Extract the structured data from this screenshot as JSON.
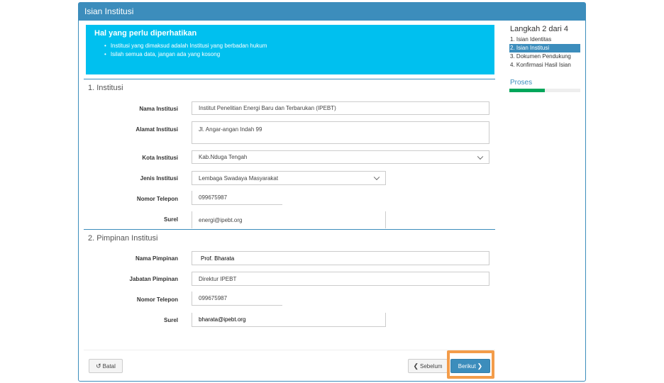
{
  "panel": {
    "title": "Isian Institusi"
  },
  "alert": {
    "heading": "Hal yang perlu diperhatikan",
    "items": [
      "Institusi yang dimaksud adalah Institusi yang berbadan hukum",
      "Isilah semua data, jangan ada yang kosong"
    ]
  },
  "section1": {
    "title": "1. Institusi",
    "fields": {
      "nama": {
        "label": "Nama Institusi",
        "value": "Institut Penelitian Energi Baru dan Terbarukan (IPEBT)"
      },
      "alamat": {
        "label": "Alamat Institusi",
        "value": "Jl. Angar-angan Indah 99"
      },
      "kota": {
        "label": "Kota Institusi",
        "value": "Kab.Nduga Tengah"
      },
      "jenis": {
        "label": "Jenis Institusi",
        "value": "Lembaga Swadaya Masyarakat"
      },
      "telepon": {
        "label": "Nomor Telepon",
        "value": "099675987"
      },
      "surel": {
        "label": "Surel",
        "value": "energi@ipebt.org"
      }
    }
  },
  "section2": {
    "title": "2. Pimpinan Institusi",
    "fields": {
      "nama": {
        "label": "Nama Pimpinan",
        "value": "Prof. Bharata"
      },
      "jabatan": {
        "label": "Jabatan Pimpinan",
        "value": "Direktur IPEBT"
      },
      "telepon": {
        "label": "Nomor Telepon",
        "value": "099675987"
      },
      "surel": {
        "label": "Surel",
        "value": "bharata@ipebt.org"
      }
    }
  },
  "buttons": {
    "batal": {
      "label": "Batal",
      "icon": "undo-icon"
    },
    "sebelum": {
      "label": "Sebelum",
      "icon": "chevron-left-icon"
    },
    "berikut": {
      "label": "Berikut",
      "icon": "chevron-right-icon"
    }
  },
  "sidebar": {
    "step_title": "Langkah 2 dari 4",
    "steps": [
      "1. Isian Identitas",
      "2. Isian Institusi",
      "3. Dokumen Pendukung",
      "4. Konfirmasi Hasil Isian"
    ],
    "active_step": 1,
    "progress_title": "Proses",
    "progress_fraction": 0.5
  },
  "colors": {
    "primary": "#3c8dbc",
    "alert": "#00c0ef",
    "progress": "#00a65a",
    "highlight": "#f39c4a"
  }
}
